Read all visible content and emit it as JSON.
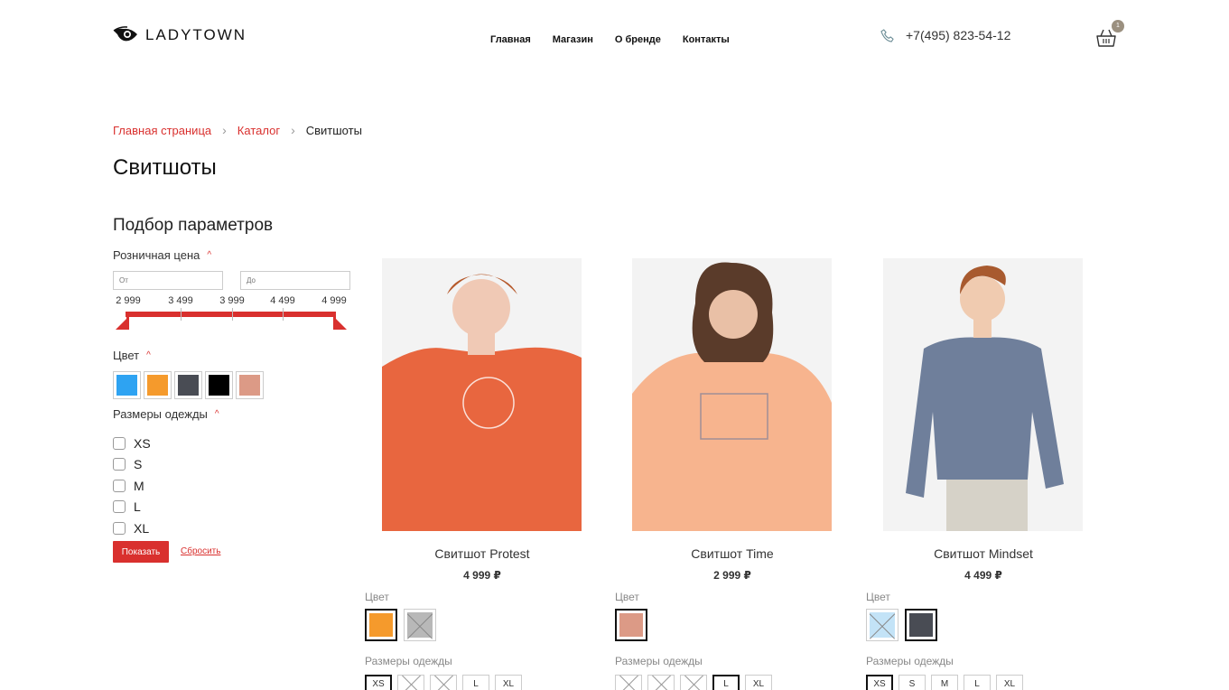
{
  "header": {
    "logo_text": "LADYTOWN",
    "nav": [
      "Главная",
      "Магазин",
      "О бренде",
      "Контакты"
    ],
    "phone": "+7(495) 823-54-12",
    "cart_count": "1"
  },
  "breadcrumb": {
    "items": [
      "Главная страница",
      "Каталог"
    ],
    "current": "Свитшоты"
  },
  "page_title": "Свитшоты",
  "filter": {
    "title": "Подбор параметров",
    "price_label": "Розничная цена",
    "from_placeholder": "От",
    "to_placeholder": "До",
    "ticks": [
      "2 999",
      "3 499",
      "3 999",
      "4 499",
      "4 999"
    ],
    "color_label": "Цвет",
    "colors": [
      "#2ea3f2",
      "#f59a2c",
      "#494c54",
      "#000000",
      "#dc9a86"
    ],
    "size_label": "Размеры одежды",
    "sizes": [
      "XS",
      "S",
      "M",
      "L",
      "XL"
    ],
    "show_button": "Показать",
    "reset_link": "Сбросить"
  },
  "products": [
    {
      "name": "Свитшот Protest",
      "price": "4 999 ₽",
      "color_label": "Цвет",
      "size_label": "Размеры одежды",
      "image_color": "#e8663f",
      "colors": [
        {
          "hex": "#f59a2c",
          "selected": true,
          "available": true
        },
        {
          "hex": "#b8b8b8",
          "selected": false,
          "available": false
        }
      ],
      "sizes": [
        {
          "label": "XS",
          "selected": true,
          "available": true
        },
        {
          "label": "S",
          "selected": false,
          "available": false
        },
        {
          "label": "M",
          "selected": false,
          "available": false
        },
        {
          "label": "L",
          "selected": false,
          "available": true
        },
        {
          "label": "XL",
          "selected": false,
          "available": true
        }
      ]
    },
    {
      "name": "Свитшот Time",
      "price": "2 999 ₽",
      "color_label": "Цвет",
      "size_label": "Размеры одежды",
      "image_color": "#f7b48e",
      "colors": [
        {
          "hex": "#dc9a86",
          "selected": true,
          "available": true
        }
      ],
      "sizes": [
        {
          "label": "XS",
          "selected": false,
          "available": false
        },
        {
          "label": "S",
          "selected": false,
          "available": false
        },
        {
          "label": "M",
          "selected": false,
          "available": false
        },
        {
          "label": "L",
          "selected": true,
          "available": true
        },
        {
          "label": "XL",
          "selected": false,
          "available": true
        }
      ]
    },
    {
      "name": "Свитшот Mindset",
      "price": "4 499 ₽",
      "color_label": "Цвет",
      "size_label": "Размеры одежды",
      "image_color": "#6f7f9b",
      "colors": [
        {
          "hex": "#c3e3f7",
          "selected": false,
          "available": false
        },
        {
          "hex": "#494c54",
          "selected": true,
          "available": true
        }
      ],
      "sizes": [
        {
          "label": "XS",
          "selected": true,
          "available": true
        },
        {
          "label": "S",
          "selected": false,
          "available": true
        },
        {
          "label": "M",
          "selected": false,
          "available": true
        },
        {
          "label": "L",
          "selected": false,
          "available": true
        },
        {
          "label": "XL",
          "selected": false,
          "available": true
        }
      ]
    }
  ]
}
